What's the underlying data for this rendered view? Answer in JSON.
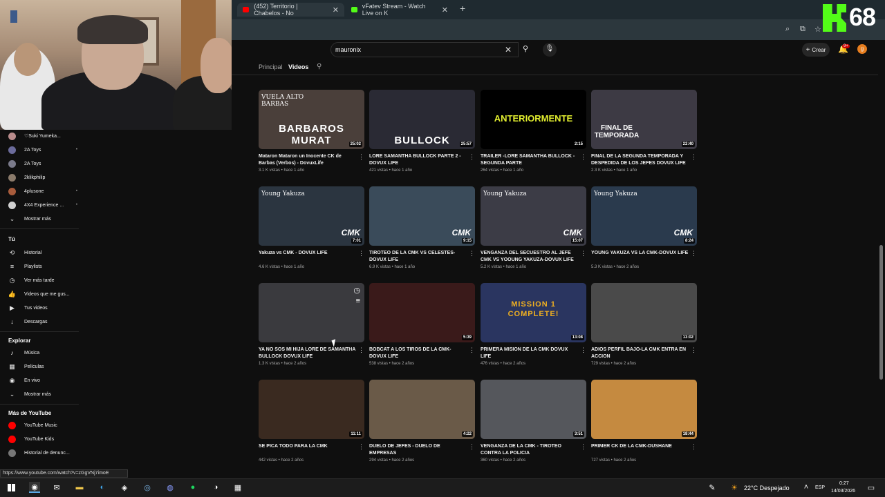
{
  "browser": {
    "tabs": [
      {
        "label": "(452) Territorio | Chabelos - No",
        "favicon_color": "#ff0000"
      },
      {
        "label": "vFatev Stream - Watch Live on K",
        "favicon_color": "#53fc18"
      }
    ],
    "new_tab": "+",
    "close": "✕"
  },
  "overlay": {
    "kick_viewers": "68"
  },
  "youtube": {
    "search_value": "mauronix",
    "create_label": "Crear",
    "notif_count": "9+",
    "avatar_letter": "g",
    "channel_tabs": [
      "Principal",
      "Videos"
    ]
  },
  "sidebar": {
    "subs": [
      {
        "label": "♡Suki Yumeka...",
        "color": "#b98c8c",
        "dot": ""
      },
      {
        "label": "2A Toys",
        "color": "#6b6b9b",
        "dot": "•"
      },
      {
        "label": "2A Toys",
        "color": "#7b7b8b",
        "dot": ""
      },
      {
        "label": "2klikphilip",
        "color": "#8b7b6b",
        "dot": ""
      },
      {
        "label": "4plusone",
        "color": "#a85c3c",
        "dot": "•"
      },
      {
        "label": "4X4 Experience ...",
        "color": "#d0d0d0",
        "dot": "•"
      },
      {
        "label": "Mostrar más",
        "icon": "⌄"
      }
    ],
    "you_heading": "Tú",
    "you_items": [
      {
        "label": "Historial",
        "icon": "⟲"
      },
      {
        "label": "Playlists",
        "icon": "≡"
      },
      {
        "label": "Ver más tarde",
        "icon": "◷"
      },
      {
        "label": "Videos que me gus...",
        "icon": "👍"
      },
      {
        "label": "Tus videos",
        "icon": "▶"
      },
      {
        "label": "Descargas",
        "icon": "↓"
      }
    ],
    "explore_heading": "Explorar",
    "explore_items": [
      {
        "label": "Música",
        "icon": "♪"
      },
      {
        "label": "Películas",
        "icon": "▦"
      },
      {
        "label": "En vivo",
        "icon": "◉"
      },
      {
        "label": "Mostrar más",
        "icon": "⌄"
      }
    ],
    "more_heading": "Más de YouTube",
    "more_items": [
      {
        "label": "YouTube Music",
        "color": "#ff0000"
      },
      {
        "label": "YouTube Kids",
        "color": "#ff0000"
      },
      {
        "label": "Historial de denunc...",
        "color": "#777777"
      }
    ],
    "status_url": "https://www.youtube.com/watch?v=zGgVNj7imoE"
  },
  "videos": [
    {
      "title": "Mataron Mataron un Inocente CK de Barbas (Verbos) - DovuxLife",
      "meta": "3.1 K vistas • hace 1 año",
      "duration": "25:02",
      "bg": "#4a3f3a",
      "overlay": "BARBAROS MURAT",
      "overlay_top": "VUELA ALTO BARBAS"
    },
    {
      "title": "LORE SAMANTHA BULLOCK PARTE 2 - DOVUX LIFE",
      "meta": "421 vistas • hace 1 año",
      "duration": "25:57",
      "bg": "#2a2a34",
      "overlay": "BULLOCK",
      "overlay_top": ""
    },
    {
      "title": "TRAILER -LORE SAMANTHA BULLOCK - SEGUNDA PARTE",
      "meta": "264 vistas • hace 1 año",
      "duration": "2:15",
      "bg": "#000000",
      "overlay": "ANTERIORMENTE",
      "overlay_top": ""
    },
    {
      "title": "FINAL DE LA SEGUNDA TEMPORADA Y DESPEDIDA DE LOS JEFES DOVUX LIFE",
      "meta": "2.3 K vistas • hace 1 año",
      "duration": "22:40",
      "bg": "#3d3a44",
      "overlay": "FINAL DE TEMPORADA",
      "overlay_top": ""
    },
    {
      "title": "Yakuza vs CMK - DOVUX LIFE",
      "meta": "4.6 K vistas • hace 1 año",
      "duration": "7:01",
      "bg": "#2b3540",
      "overlay": "CMK",
      "overlay_top": "Young Yakuza"
    },
    {
      "title": "TIROTEO DE LA CMK VS CELESTES-DOVUX LIFE",
      "meta": "6.9 K vistas • hace 1 año",
      "duration": "9:15",
      "bg": "#3a4b5a",
      "overlay": "CMK",
      "overlay_top": ""
    },
    {
      "title": "VENGANZA DEL SECUESTRO AL JEFE CMK VS YOOUNG YAKUZA-DOVUX LIFE",
      "meta": "5.2 K vistas • hace 1 año",
      "duration": "15:07",
      "bg": "#3c3c46",
      "overlay": "CMK",
      "overlay_top": "Young Yakuza"
    },
    {
      "title": "YOUNG YAKUZA VS LA CMK-DOVUX LIFE",
      "meta": "5.3 K vistas • hace 2 años",
      "duration": "8:24",
      "bg": "#2a3a4d",
      "overlay": "CMK",
      "overlay_top": "Young Yakuza"
    },
    {
      "title": "YA NO SOS MI HIJA LORE DE SAMANTHA BULLOCK DOVUX LIFE",
      "meta": "1.3 K vistas • hace 2 años",
      "duration": "",
      "bg": "#3a3a3e",
      "overlay": "",
      "overlay_top": ""
    },
    {
      "title": "BOBCAT A LOS TIROS DE LA CMK-DOVUX LIFE",
      "meta": "538 vistas • hace 2 años",
      "duration": "5:39",
      "bg": "#3a1a1a",
      "overlay": "",
      "overlay_top": ""
    },
    {
      "title": "PRIMERA MISION DE LA CMK DOVUX LIFE",
      "meta": "476 vistas • hace 2 años",
      "duration": "13:08",
      "bg": "#2a3560",
      "overlay": "MISSION 1 COMPLETE!",
      "overlay_top": ""
    },
    {
      "title": "ADIOS PERFIL BAJO-LA CMK ENTRA EN ACCION",
      "meta": "729 vistas • hace 2 años",
      "duration": "13:02",
      "bg": "#4a4a4a",
      "overlay": "",
      "overlay_top": ""
    },
    {
      "title": "SE PICA TODO PARA LA CMK",
      "meta": "442 vistas • hace 2 años",
      "duration": "11:11",
      "bg": "#3a2a20",
      "overlay": "",
      "overlay_top": ""
    },
    {
      "title": "DUELO DE JEFES - DUELO DE EMPRESAS",
      "meta": "294 vistas • hace 2 años",
      "duration": "4:22",
      "bg": "#6a5a48",
      "overlay": "",
      "overlay_top": ""
    },
    {
      "title": "VENGANZA DE LA CMK - TIROTEO CONTRA LA POLICIA",
      "meta": "360 vistas • hace 2 años",
      "duration": "3:51",
      "bg": "#55575c",
      "overlay": "",
      "overlay_top": ""
    },
    {
      "title": "PRIMER CK DE LA CMK-DUSHANE",
      "meta": "727 vistas • hace 2 años",
      "duration": "18:44",
      "bg": "#c58a40",
      "overlay": "",
      "overlay_top": ""
    }
  ],
  "taskbar": {
    "weather": "22°C  Despejado",
    "lang": "ESP",
    "time": "0:27",
    "date": "14/03/2026"
  }
}
